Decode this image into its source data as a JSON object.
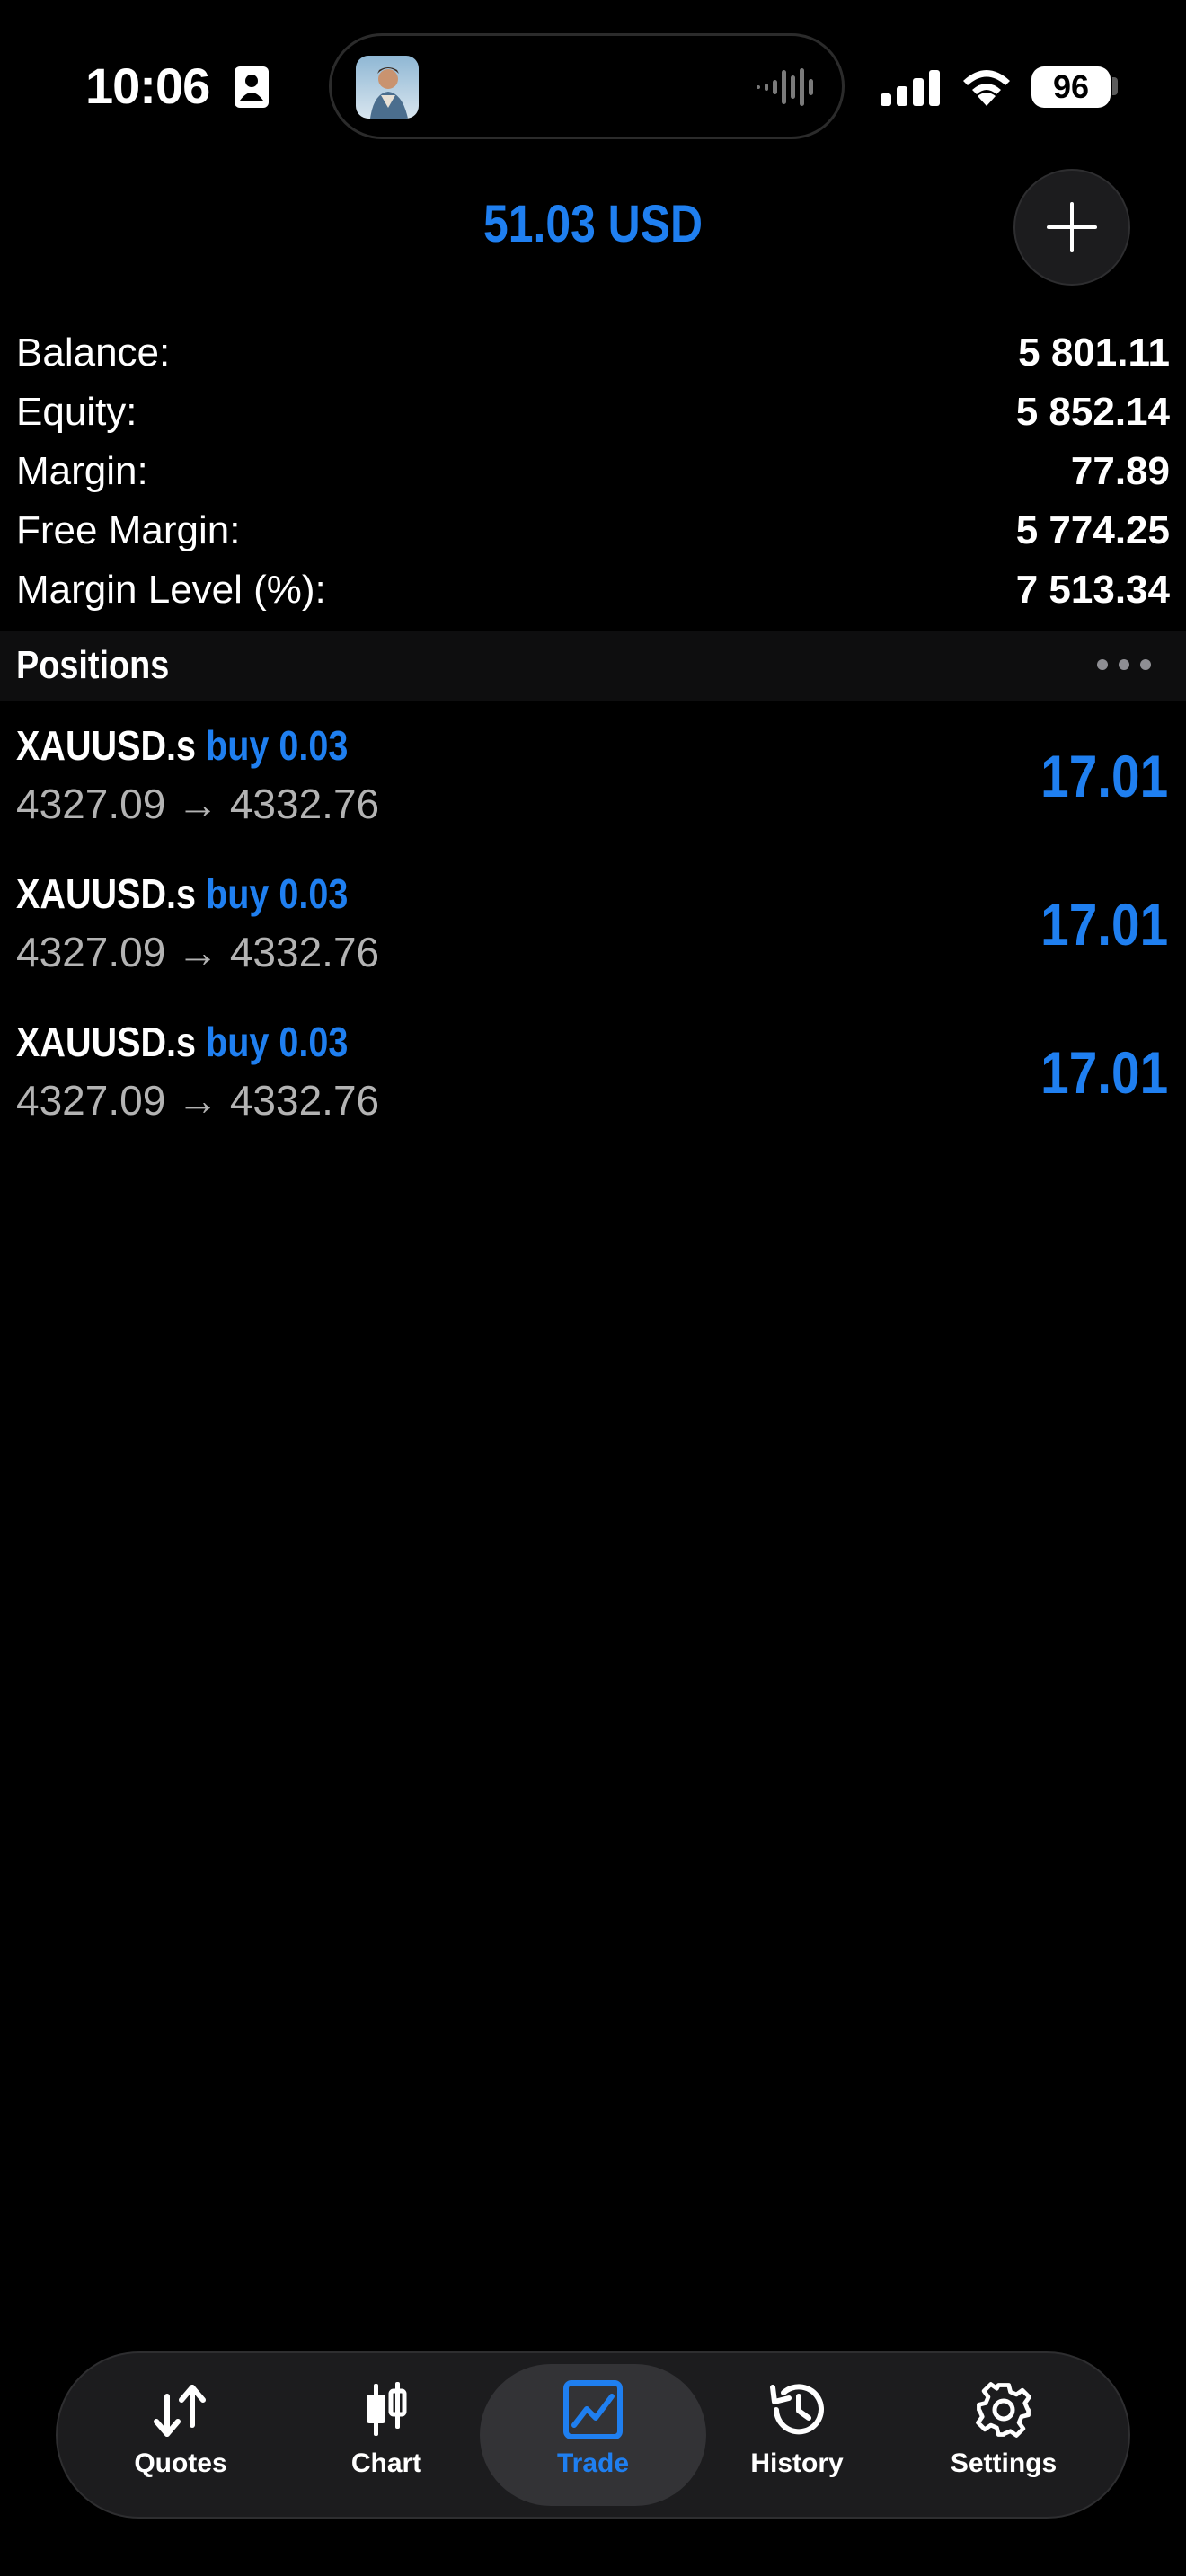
{
  "status_bar": {
    "time": "10:06",
    "battery": "96"
  },
  "header": {
    "profit_total": "51.03 USD"
  },
  "account": [
    {
      "label": "Balance:",
      "value": "5 801.11"
    },
    {
      "label": "Equity:",
      "value": "5 852.14"
    },
    {
      "label": "Margin:",
      "value": "77.89"
    },
    {
      "label": "Free Margin:",
      "value": "5 774.25"
    },
    {
      "label": "Margin Level (%):",
      "value": "7 513.34"
    }
  ],
  "positions": {
    "title": "Positions",
    "items": [
      {
        "symbol": "XAUUSD.s",
        "type": "buy 0.03",
        "open_price": "4327.09",
        "arrow": "→",
        "current_price": "4332.76",
        "profit": "17.01"
      },
      {
        "symbol": "XAUUSD.s",
        "type": "buy 0.03",
        "open_price": "4327.09",
        "arrow": "→",
        "current_price": "4332.76",
        "profit": "17.01"
      },
      {
        "symbol": "XAUUSD.s",
        "type": "buy 0.03",
        "open_price": "4327.09",
        "arrow": "→",
        "current_price": "4332.76",
        "profit": "17.01"
      }
    ]
  },
  "tabs": [
    {
      "label": "Quotes",
      "icon": "quotes-arrows-icon"
    },
    {
      "label": "Chart",
      "icon": "candlestick-icon"
    },
    {
      "label": "Trade",
      "icon": "trade-chart-icon",
      "active": true
    },
    {
      "label": "History",
      "icon": "history-clock-icon"
    },
    {
      "label": "Settings",
      "icon": "gear-icon"
    }
  ],
  "colors": {
    "accent": "#1f7ff0",
    "background": "#000000",
    "secondary_text": "#b3b3b3",
    "panel": "#1c1c1e"
  }
}
